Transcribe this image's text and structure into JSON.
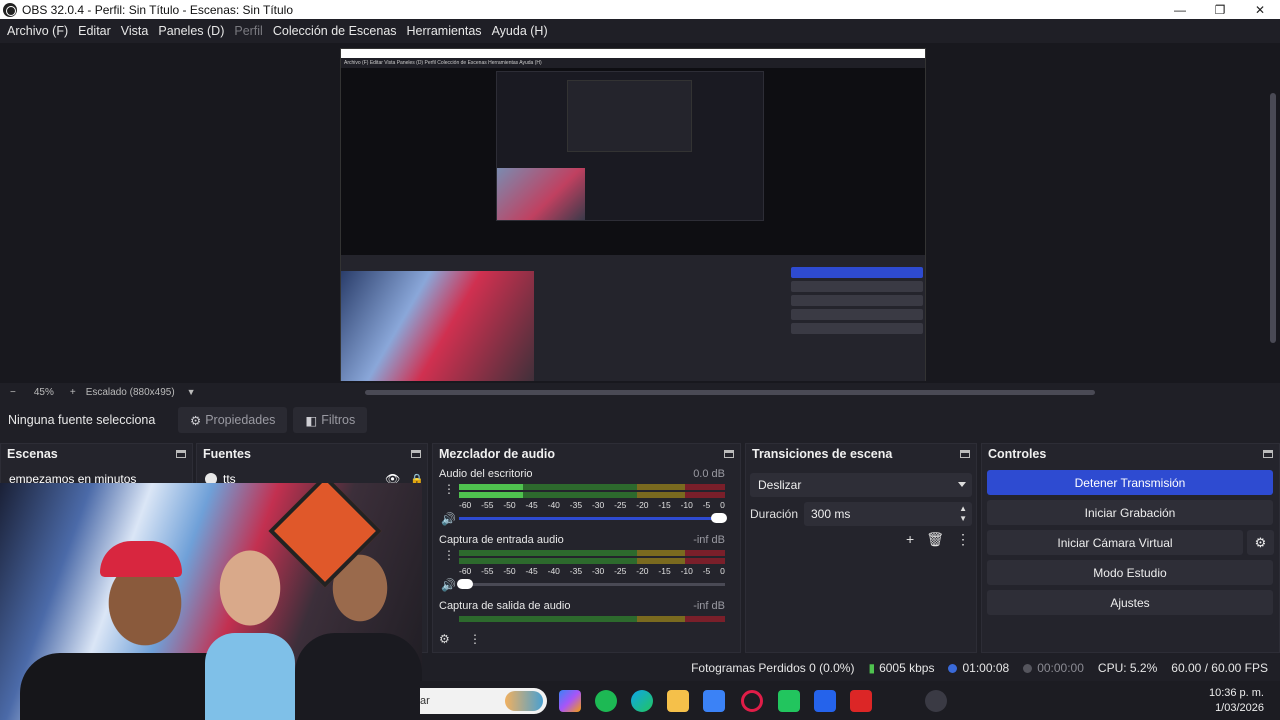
{
  "window": {
    "title": "OBS 32.0.4 - Perfil: Sin Título - Escenas: Sin Título",
    "minimize": "—",
    "maximize": "❐",
    "close": "✕"
  },
  "menu": [
    {
      "label": "Archivo (F)"
    },
    {
      "label": "Editar"
    },
    {
      "label": "Vista"
    },
    {
      "label": "Paneles (D)"
    },
    {
      "label": "Perfil"
    },
    {
      "label": "Colección de Escenas"
    },
    {
      "label": "Herramientas"
    },
    {
      "label": "Ayuda (H)"
    }
  ],
  "zoom": {
    "minus": "−",
    "value": "45%",
    "plus": "+",
    "scale": "Escalado (880x495)"
  },
  "source_toolbar": {
    "no_selection": "Ninguna fuente selecciona",
    "properties": "Propiedades",
    "filters": "Filtros"
  },
  "scenes": {
    "title": "Escenas",
    "items": [
      "empezamos en minutos"
    ]
  },
  "sources": {
    "title": "Fuentes",
    "items": [
      {
        "name": "tts"
      }
    ]
  },
  "mixer": {
    "title": "Mezclador de audio",
    "ticks": [
      "-60",
      "-55",
      "-50",
      "-45",
      "-40",
      "-35",
      "-30",
      "-25",
      "-20",
      "-15",
      "-10",
      "-5",
      "0"
    ],
    "channels": [
      {
        "name": "Audio del escritorio",
        "db": "0.0 dB",
        "level": 1.0,
        "muted": false
      },
      {
        "name": "Captura de entrada audio",
        "db": "-inf dB",
        "level": 0.0,
        "muted": false
      },
      {
        "name": "Captura de salida de audio",
        "db": "-inf dB"
      }
    ]
  },
  "transitions": {
    "title": "Transiciones de escena",
    "selected": "Deslizar",
    "duration_label": "Duración",
    "duration_value": "300 ms"
  },
  "controls": {
    "title": "Controles",
    "buttons": {
      "stop_stream": "Detener Transmisión",
      "start_recording": "Iniciar Grabación",
      "virtual_camera": "Iniciar Cámara Virtual",
      "studio_mode": "Modo Estudio",
      "settings": "Ajustes"
    }
  },
  "status": {
    "dropped_frames": "Fotogramas Perdidos 0 (0.0%)",
    "bitrate": "6005 kbps",
    "stream_time": "01:00:08",
    "record_time": "00:00:00",
    "cpu": "CPU: 5.2%",
    "fps": "60.00 / 60.00 FPS"
  },
  "taskbar": {
    "search_text": "ar",
    "time": "10:36 p. m.",
    "date": "1/03/2026"
  },
  "nested_preview": {
    "menu_text": "Archivo (F)   Editar   Vista   Paneles (D)   Perfil   Colección de Escenas   Herramientas   Ayuda (H)"
  },
  "colors": {
    "accent": "#2e4bd1",
    "background": "#1f1f26",
    "dock": "#24242c"
  }
}
